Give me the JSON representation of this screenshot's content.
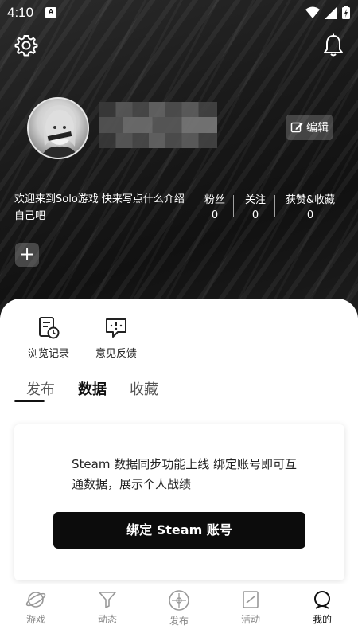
{
  "status_bar": {
    "time": "4:10",
    "notification_letter": "A"
  },
  "profile": {
    "bio": "欢迎来到Solo游戏 快来写点什么介绍自己吧",
    "edit_label": "编辑",
    "stats": [
      {
        "label": "粉丝",
        "value": "0"
      },
      {
        "label": "关注",
        "value": "0"
      },
      {
        "label": "获赞&收藏",
        "value": "0"
      }
    ],
    "add_symbol": "+"
  },
  "quick_actions": [
    {
      "label": "浏览记录",
      "icon": "history-icon"
    },
    {
      "label": "意见反馈",
      "icon": "feedback-icon"
    }
  ],
  "tabs": [
    {
      "label": "发布",
      "active": true
    },
    {
      "label": "数据",
      "active": false
    },
    {
      "label": "收藏",
      "active": false
    }
  ],
  "steam_card": {
    "message": "Steam 数据同步功能上线 绑定账号即可互通数据，展示个人战绩",
    "button_label": "绑定 Steam 账号"
  },
  "bottom_nav": [
    {
      "label": "游戏",
      "icon": "planet-icon",
      "active": false
    },
    {
      "label": "动态",
      "icon": "filter-icon",
      "active": false
    },
    {
      "label": "发布",
      "icon": "compass-icon",
      "active": false
    },
    {
      "label": "活动",
      "icon": "activity-icon",
      "active": false
    },
    {
      "label": "我的",
      "icon": "profile-icon",
      "active": true
    }
  ]
}
